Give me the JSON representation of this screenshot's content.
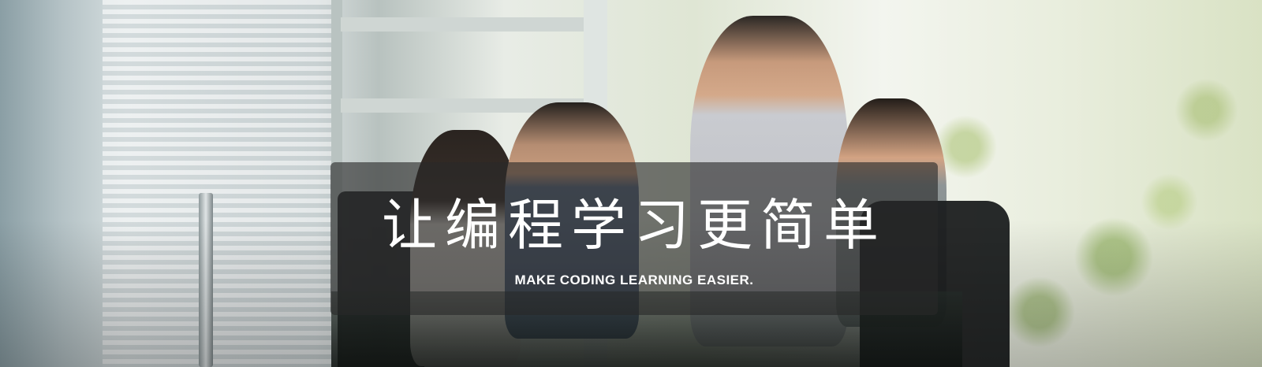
{
  "banner": {
    "headline": "让编程学习更简单",
    "subheadline": "MAKE CODING LEARNING EASIER.",
    "overlay_color": "#282828",
    "text_color": "#ffffff"
  }
}
